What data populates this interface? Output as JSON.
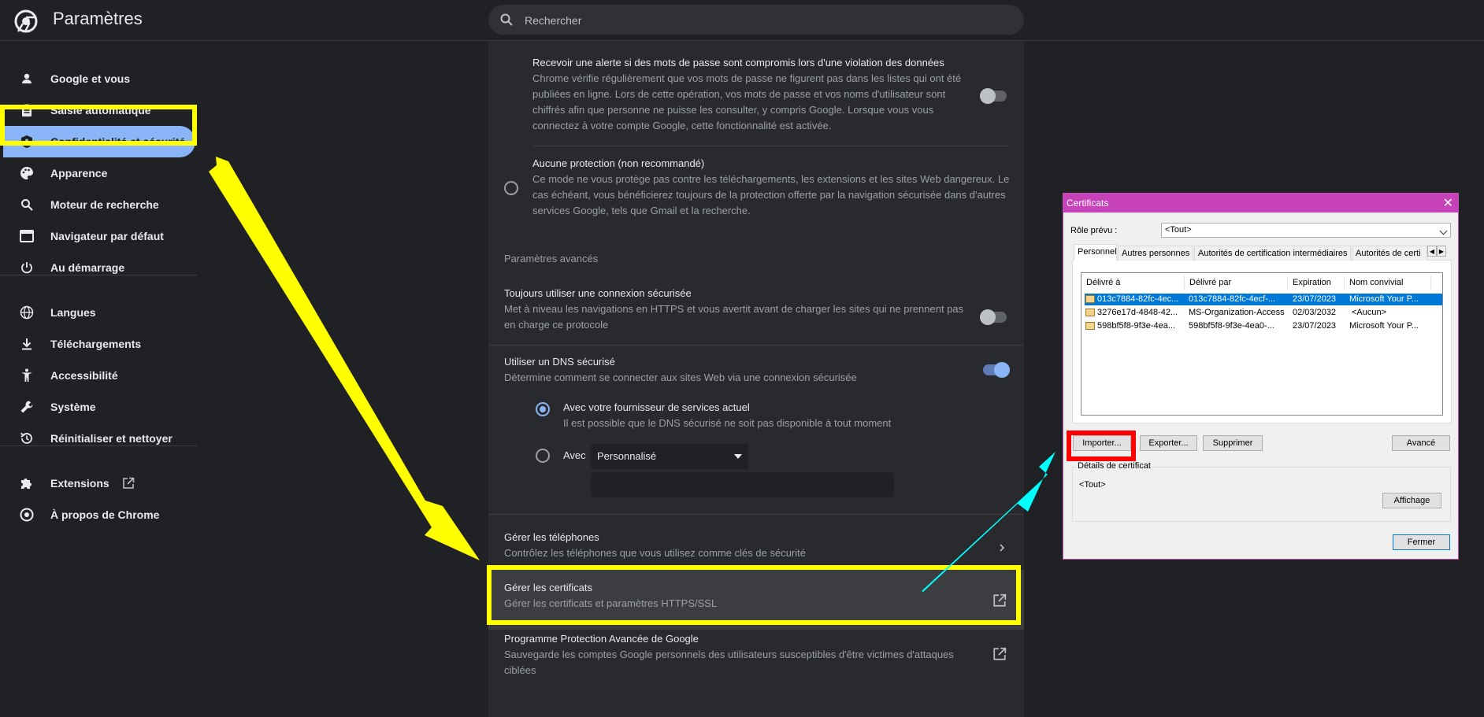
{
  "app": {
    "title": "Paramètres",
    "brand_color": "#202124",
    "accent": "#8ab4f8"
  },
  "search": {
    "placeholder": "Rechercher"
  },
  "sidebar": {
    "items": [
      {
        "label": "Google et vous",
        "icon": "person-icon"
      },
      {
        "label": "Saisie automatique",
        "icon": "clipboard-icon"
      },
      {
        "label": "Confidentialité et sécurité",
        "icon": "shield-icon",
        "active": true
      },
      {
        "label": "Apparence",
        "icon": "palette-icon"
      },
      {
        "label": "Moteur de recherche",
        "icon": "search-icon"
      },
      {
        "label": "Navigateur par défaut",
        "icon": "browser-icon"
      },
      {
        "label": "Au démarrage",
        "icon": "power-icon"
      },
      {
        "label": "Langues",
        "icon": "globe-icon"
      },
      {
        "label": "Téléchargements",
        "icon": "download-icon"
      },
      {
        "label": "Accessibilité",
        "icon": "accessibility-icon"
      },
      {
        "label": "Système",
        "icon": "wrench-icon"
      },
      {
        "label": "Réinitialiser et nettoyer",
        "icon": "reset-icon"
      },
      {
        "label": "Extensions",
        "icon": "puzzle-icon"
      },
      {
        "label": "À propos de Chrome",
        "icon": "chrome-icon"
      }
    ]
  },
  "main": {
    "breach_alert": {
      "title": "Recevoir une alerte si des mots de passe sont compromis lors d'une violation des données",
      "desc": "Chrome vérifie régulièrement que vos mots de passe ne figurent pas dans les listes qui ont été publiées en ligne. Lors de cette opération, vos mots de passe et vos noms d'utilisateur sont chiffrés afin que personne ne puisse les consulter, y compris Google. Lorsque vous vous connectez à votre compte Google, cette fonctionnalité est activée."
    },
    "no_protection": {
      "title": "Aucune protection (non recommandé)",
      "desc": "Ce mode ne vous protège pas contre les téléchargements, les extensions et les sites Web dangereux. Le cas échéant, vous bénéficierez toujours de la protection offerte par la navigation sécurisée dans d'autres services Google, tels que Gmail et la recherche."
    },
    "advanced_header": "Paramètres avancés",
    "https": {
      "title": "Toujours utiliser une connexion sécurisée",
      "desc": "Met à niveau les navigations en HTTPS et vous avertit avant de charger les sites qui ne prennent pas en charge ce protocole"
    },
    "dns": {
      "title": "Utiliser un DNS sécurisé",
      "desc": "Détermine comment se connecter aux sites Web via une connexion sécurisée",
      "option1_title": "Avec votre fournisseur de services actuel",
      "option1_desc": "Il est possible que le DNS sécurisé ne soit pas disponible à tout moment",
      "option2_label": "Avec",
      "select_value": "Personnalisé"
    },
    "phones": {
      "title": "Gérer les téléphones",
      "desc": "Contrôlez les téléphones que vous utilisez comme clés de sécurité"
    },
    "certs": {
      "title": "Gérer les certificats",
      "desc": "Gérer les certificats et paramètres HTTPS/SSL"
    },
    "advanced_protection": {
      "title": "Programme Protection Avancée de Google",
      "desc": "Sauvegarde les comptes Google personnels des utilisateurs susceptibles d'être victimes d'attaques ciblées"
    }
  },
  "dialog": {
    "title": "Certificats",
    "role_label": "Rôle prévu :",
    "role_value": "<Tout>",
    "tabs": [
      "Personnel",
      "Autres personnes",
      "Autorités de certification intermédiaires",
      "Autorités de certi"
    ],
    "columns": [
      "Délivré à",
      "Délivré par",
      "Expiration",
      "Nom convivial"
    ],
    "rows": [
      [
        "013c7884-82fc-4ec...",
        "013c7884-82fc-4ecf-...",
        "23/07/2023",
        "Microsoft Your P..."
      ],
      [
        "3276e17d-4848-42...",
        "MS-Organization-Access",
        "02/03/2032",
        "<Aucun>"
      ],
      [
        "598bf5f8-9f3e-4ea...",
        "598bf5f8-9f3e-4ea0-...",
        "23/07/2023",
        "Microsoft Your P..."
      ]
    ],
    "buttons": {
      "import": "Importer...",
      "export": "Exporter...",
      "remove": "Supprimer",
      "advanced": "Avancé",
      "view": "Affichage",
      "close": "Fermer"
    },
    "details_label": "Détails de certificat",
    "details_value": "<Tout>"
  }
}
